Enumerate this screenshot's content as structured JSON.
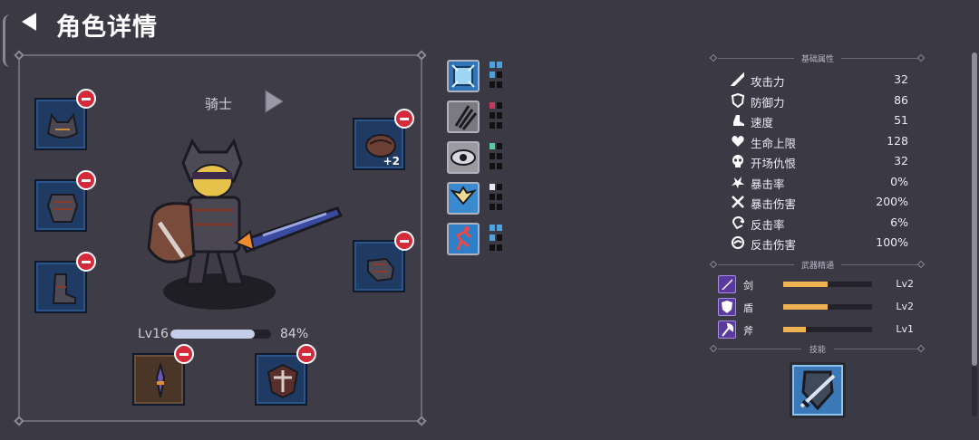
{
  "header": {
    "title": "角色详情"
  },
  "character": {
    "class_name": "骑士",
    "level": "Lv16",
    "xp_percent": "84%",
    "xp_fraction": 0.84
  },
  "equipment": {
    "left": [
      {
        "icon": "wolf-helmet-icon"
      },
      {
        "icon": "chest-armor-icon"
      },
      {
        "icon": "boots-icon"
      }
    ],
    "right": [
      {
        "icon": "leather-pouch-icon",
        "enhance": "+2"
      },
      {
        "icon": "gauntlet-icon"
      }
    ],
    "weapon": {
      "icon": "spear-icon"
    },
    "shield": {
      "icon": "shield-icon"
    }
  },
  "skills": [
    {
      "icon": "frost-shield-skill-icon",
      "color": "#4aa3e0",
      "pips": 2
    },
    {
      "icon": "claw-slash-skill-icon",
      "color": "#c23a5e",
      "pips": 1
    },
    {
      "icon": "eye-skill-icon",
      "color": "#58c9a0",
      "pips": 1
    },
    {
      "icon": "wings-skill-icon",
      "color": "#e8e8f0",
      "pips": 1
    },
    {
      "icon": "runner-skill-icon",
      "color": "#4aa3e0",
      "pips": 2
    }
  ],
  "stats_section": {
    "title": "基础属性"
  },
  "stats": [
    {
      "icon": "sword-icon",
      "name": "攻击力",
      "value": "32"
    },
    {
      "icon": "shield-outline-icon",
      "name": "防御力",
      "value": "86"
    },
    {
      "icon": "boot-speed-icon",
      "name": "速度",
      "value": "51"
    },
    {
      "icon": "heart-icon",
      "name": "生命上限",
      "value": "128"
    },
    {
      "icon": "skull-icon",
      "name": "开场仇恨",
      "value": "32"
    },
    {
      "icon": "crit-burst-icon",
      "name": "暴击率",
      "value": "0%"
    },
    {
      "icon": "crossed-swords-icon",
      "name": "暴击伤害",
      "value": "200%"
    },
    {
      "icon": "counter-icon",
      "name": "反击率",
      "value": "6%"
    },
    {
      "icon": "counter-damage-icon",
      "name": "反击伤害",
      "value": "100%"
    }
  ],
  "mastery_section": {
    "title": "武器精通"
  },
  "mastery": [
    {
      "icon": "sword-mastery-icon",
      "name": "剑",
      "level": "Lv2",
      "progress": 0.5
    },
    {
      "icon": "shield-mastery-icon",
      "name": "盾",
      "level": "Lv2",
      "progress": 0.5
    },
    {
      "icon": "axe-mastery-icon",
      "name": "斧",
      "level": "Lv1",
      "progress": 0.25
    }
  ],
  "technique_section": {
    "title": "技能"
  },
  "technique": {
    "icon": "shield-sword-skill-icon"
  },
  "colors": {
    "background": "#3b3a44",
    "panel_border": "#6d6a78",
    "slot_blue": "#1f3a63",
    "remove_red": "#d42a3a",
    "mastery_bar": "#f0b352",
    "xp_bar": "#c6cde8"
  }
}
